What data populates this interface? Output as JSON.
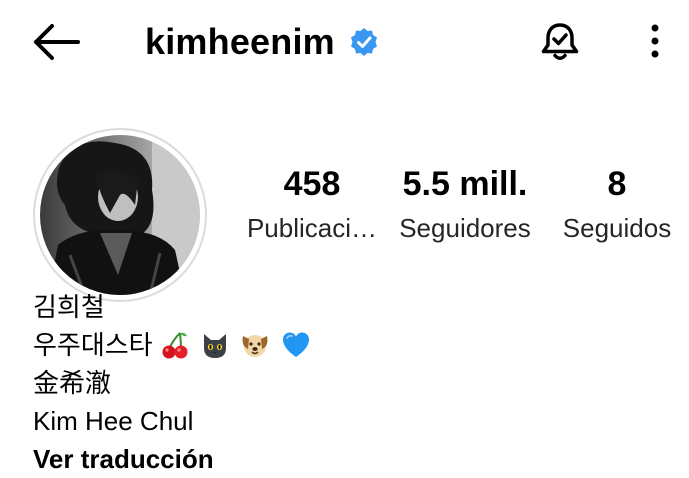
{
  "header": {
    "username": "kimheenim",
    "verified": true,
    "icons": {
      "back": "arrow-left-icon",
      "verified": "verified-badge-icon",
      "notifications": "bell-check-icon",
      "more": "vertical-dots-icon"
    },
    "colors": {
      "verified": "#3897f0"
    }
  },
  "profile": {
    "avatar": "profile-photo",
    "stats": [
      {
        "value": "458",
        "label": "Publicaci…"
      },
      {
        "value": "5.5 mill.",
        "label": "Seguidores"
      },
      {
        "value": "8",
        "label": "Seguidos"
      }
    ]
  },
  "bio": {
    "line1": "김희철",
    "line2": "우주대스타",
    "line2_emojis": [
      "cherries-emoji",
      "black-cat-emoji",
      "dog-face-emoji",
      "blue-heart-emoji"
    ],
    "line3": "金希澈",
    "line4": "Kim Hee Chul",
    "translate": "Ver traducción"
  }
}
